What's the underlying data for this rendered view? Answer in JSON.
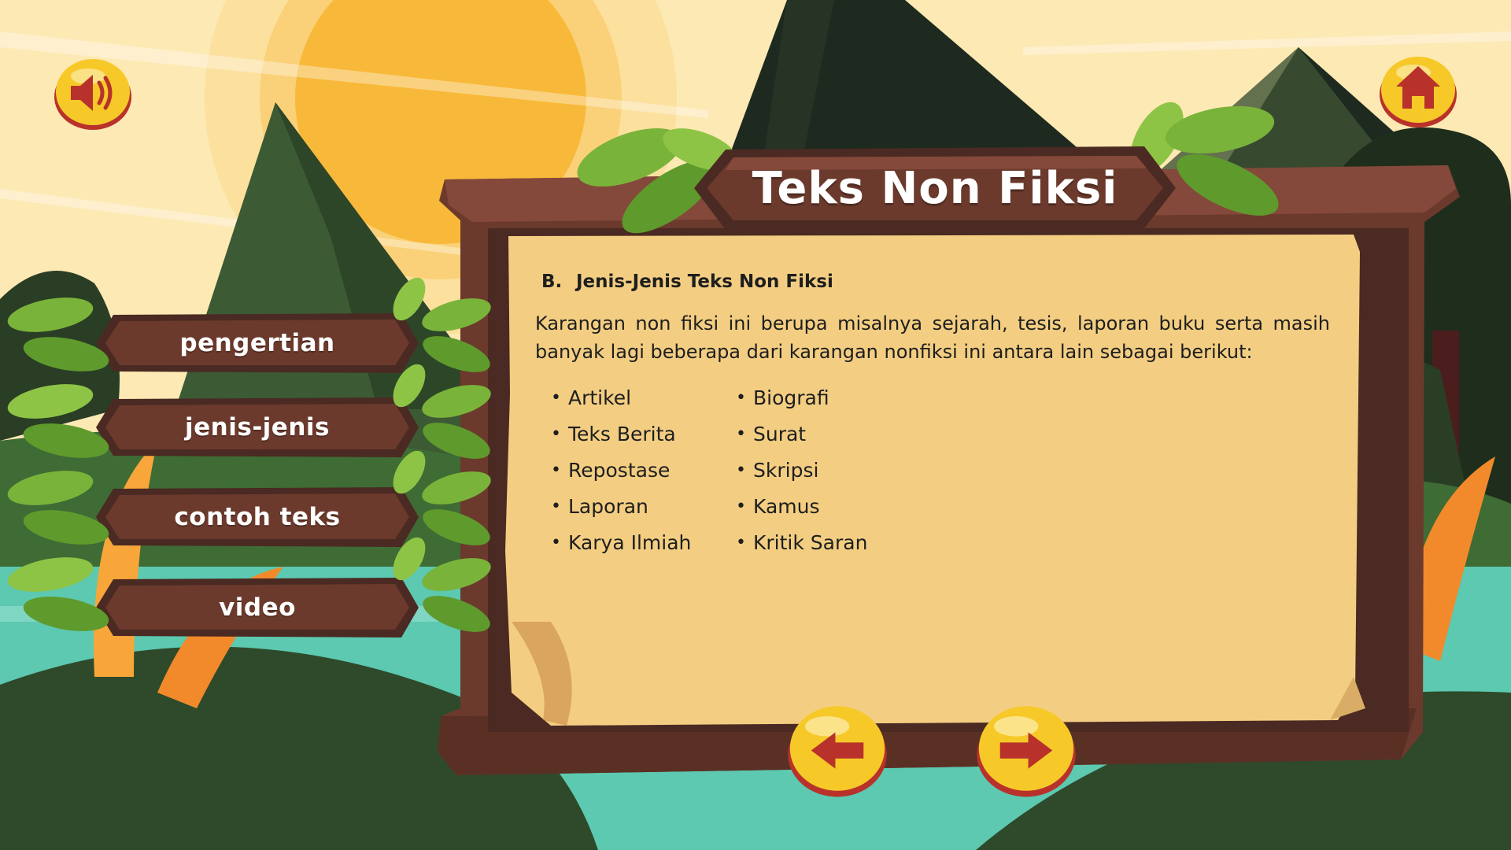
{
  "title": "Teks Non Fiksi",
  "nav": {
    "sound_icon": "speaker-icon",
    "home_icon": "home-icon",
    "prev_icon": "arrow-left-icon",
    "next_icon": "arrow-right-icon"
  },
  "menu": {
    "items": [
      {
        "label": "pengertian"
      },
      {
        "label": "jenis-jenis"
      },
      {
        "label": "contoh teks"
      },
      {
        "label": "video"
      }
    ]
  },
  "content": {
    "section_number": "B.",
    "section_title": "Jenis-Jenis Teks Non Fiksi",
    "paragraph": "Karangan non fiksi ini berupa misalnya sejarah, tesis, laporan buku serta masih banyak lagi beberapa dari karangan nonfiksi ini antara lain sebagai berikut:",
    "list_left": [
      "Artikel",
      "Teks Berita",
      "Repostase",
      "Laporan",
      "Karya Ilmiah"
    ],
    "list_right": [
      "Biografi",
      "Surat",
      "Skripsi",
      "Kamus",
      "Kritik Saran"
    ]
  },
  "colors": {
    "wood": "#6b3a2c",
    "wood_dark": "#4a2a22",
    "parchment": "#f3ce82",
    "button_yellow": "#f6c928",
    "button_red": "#b8322b",
    "sun": "#f8b93a",
    "water": "#5cc9b0"
  }
}
